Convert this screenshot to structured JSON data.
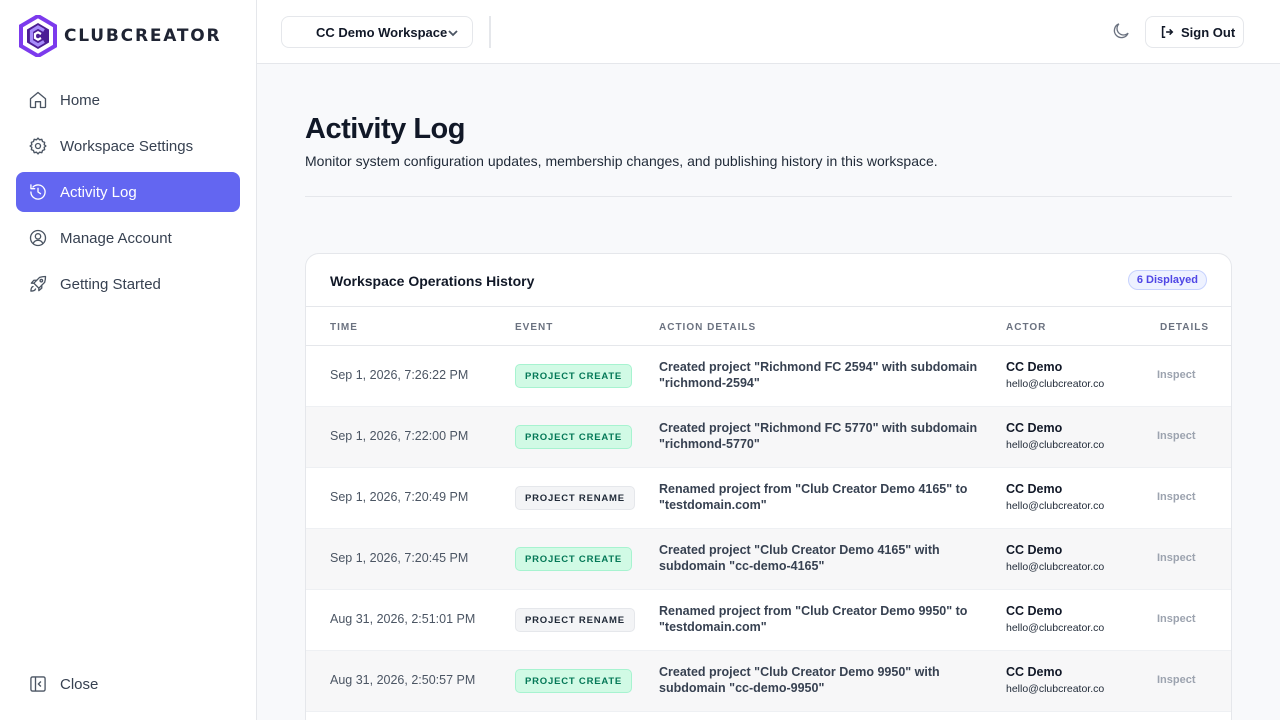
{
  "brand": {
    "name": "CLUBCREATOR",
    "accent": "#6366f1"
  },
  "sidebar": {
    "items": [
      {
        "label": "Home",
        "icon": "home-icon"
      },
      {
        "label": "Workspace Settings",
        "icon": "gear-icon"
      },
      {
        "label": "Activity Log",
        "icon": "history-icon",
        "active": true
      },
      {
        "label": "Manage Account",
        "icon": "user-circle-icon"
      },
      {
        "label": "Getting Started",
        "icon": "rocket-icon"
      }
    ],
    "close_label": "Close"
  },
  "topbar": {
    "workspace": "CC Demo Workspace",
    "sign_out": "Sign Out"
  },
  "page": {
    "title": "Activity Log",
    "subtitle": "Monitor system configuration updates, membership changes, and publishing history in this workspace."
  },
  "card": {
    "title": "Workspace Operations History",
    "badge": "6 Displayed",
    "columns": {
      "time": "TIME",
      "event": "EVENT",
      "action": "ACTION DETAILS",
      "actor": "ACTOR",
      "details": "DETAILS"
    },
    "rows": [
      {
        "time": "Sep 1, 2026, 7:26:22 PM",
        "event": "PROJECT CREATE",
        "type": "create",
        "action": "Created project \"Richmond FC 2594\" with subdomain \"richmond-2594\"",
        "actor": "CC Demo",
        "email": "hello@clubcreator.co",
        "link": "Inspect"
      },
      {
        "time": "Sep 1, 2026, 7:22:00 PM",
        "event": "PROJECT CREATE",
        "type": "create",
        "action": "Created project \"Richmond FC 5770\" with subdomain \"richmond-5770\"",
        "actor": "CC Demo",
        "email": "hello@clubcreator.co",
        "link": "Inspect"
      },
      {
        "time": "Sep 1, 2026, 7:20:49 PM",
        "event": "PROJECT RENAME",
        "type": "rename",
        "action": "Renamed project from \"Club Creator Demo 4165\" to \"testdomain.com\"",
        "actor": "CC Demo",
        "email": "hello@clubcreator.co",
        "link": "Inspect"
      },
      {
        "time": "Sep 1, 2026, 7:20:45 PM",
        "event": "PROJECT CREATE",
        "type": "create",
        "action": "Created project \"Club Creator Demo 4165\" with subdomain \"cc-demo-4165\"",
        "actor": "CC Demo",
        "email": "hello@clubcreator.co",
        "link": "Inspect"
      },
      {
        "time": "Aug 31, 2026, 2:51:01 PM",
        "event": "PROJECT RENAME",
        "type": "rename",
        "action": "Renamed project from \"Club Creator Demo 9950\" to \"testdomain.com\"",
        "actor": "CC Demo",
        "email": "hello@clubcreator.co",
        "link": "Inspect"
      },
      {
        "time": "Aug 31, 2026, 2:50:57 PM",
        "event": "PROJECT CREATE",
        "type": "create",
        "action": "Created project \"Club Creator Demo 9950\" with subdomain \"cc-demo-9950\"",
        "actor": "CC Demo",
        "email": "hello@clubcreator.co",
        "link": "Inspect"
      }
    ]
  }
}
